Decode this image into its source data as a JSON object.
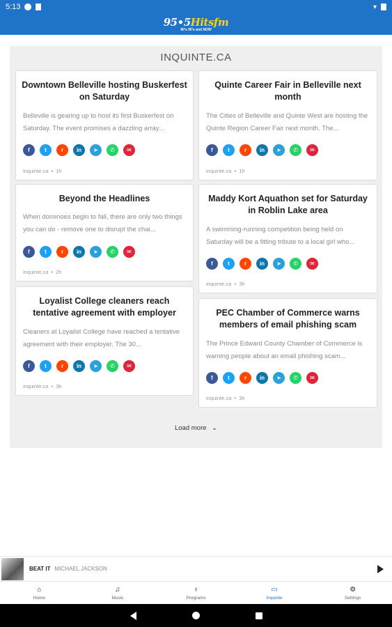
{
  "status": {
    "time": "5:13"
  },
  "app": {
    "logo_num": "95•5",
    "logo_brand": "Hitsfm",
    "logo_sub": "80's 90's and NOW"
  },
  "feed": {
    "title": "INQUINTE.CA",
    "load_more": "Load more",
    "cards": [
      {
        "title": "Downtown Belleville hosting Buskerfest on Saturday",
        "excerpt": "Belleville is gearing up to host its first Buskerfest on Saturday.   The event promises a dazzling array...",
        "source": "inquinte.ca",
        "time": "1h"
      },
      {
        "title": "Quinte Career Fair in Belleville next month",
        "excerpt": "The Cities of Belleville and Quinte West are hosting the Quinte Region Career Fair next month. The...",
        "source": "inquinte.ca",
        "time": "1h"
      },
      {
        "title": "Beyond the Headlines",
        "excerpt": "When dominoes begin to fall, there are only two things you can do - remove one to disrupt the chai...",
        "source": "inquinte.ca",
        "time": "2h"
      },
      {
        "title": "Maddy Kort Aquathon set for Saturday in Roblin Lake area",
        "excerpt": "A swimming-running competition being held on Saturday will be a fitting tribute to a local girl who...",
        "source": "inquinte.ca",
        "time": "3h"
      },
      {
        "title": "Loyalist College cleaners reach tentative agreement with employer",
        "excerpt": "Cleaners at Loyalist College have reached a tentative agreement with their employer. The 30...",
        "source": "inquinte.ca",
        "time": "3h"
      },
      {
        "title": "PEC Chamber of Commerce warns members of email phishing scam",
        "excerpt": "The Prince Edward County Chamber of Commerce is warning people about an email phishing scam...",
        "source": "inquinte.ca",
        "time": "3h"
      }
    ]
  },
  "player": {
    "track": "BEAT IT",
    "artist": "MICHAEL JACKSON"
  },
  "tabs": [
    {
      "label": "Home",
      "icon": "home-icon"
    },
    {
      "label": "Music",
      "icon": "music-icon"
    },
    {
      "label": "Programs",
      "icon": "mic-icon"
    },
    {
      "label": "Inquinte",
      "icon": "tv-icon",
      "active": true
    },
    {
      "label": "Settings",
      "icon": "gear-icon"
    }
  ],
  "colors": {
    "brand": "#1f73c9",
    "accent": "#f7d21d",
    "panel": "#efefef"
  }
}
